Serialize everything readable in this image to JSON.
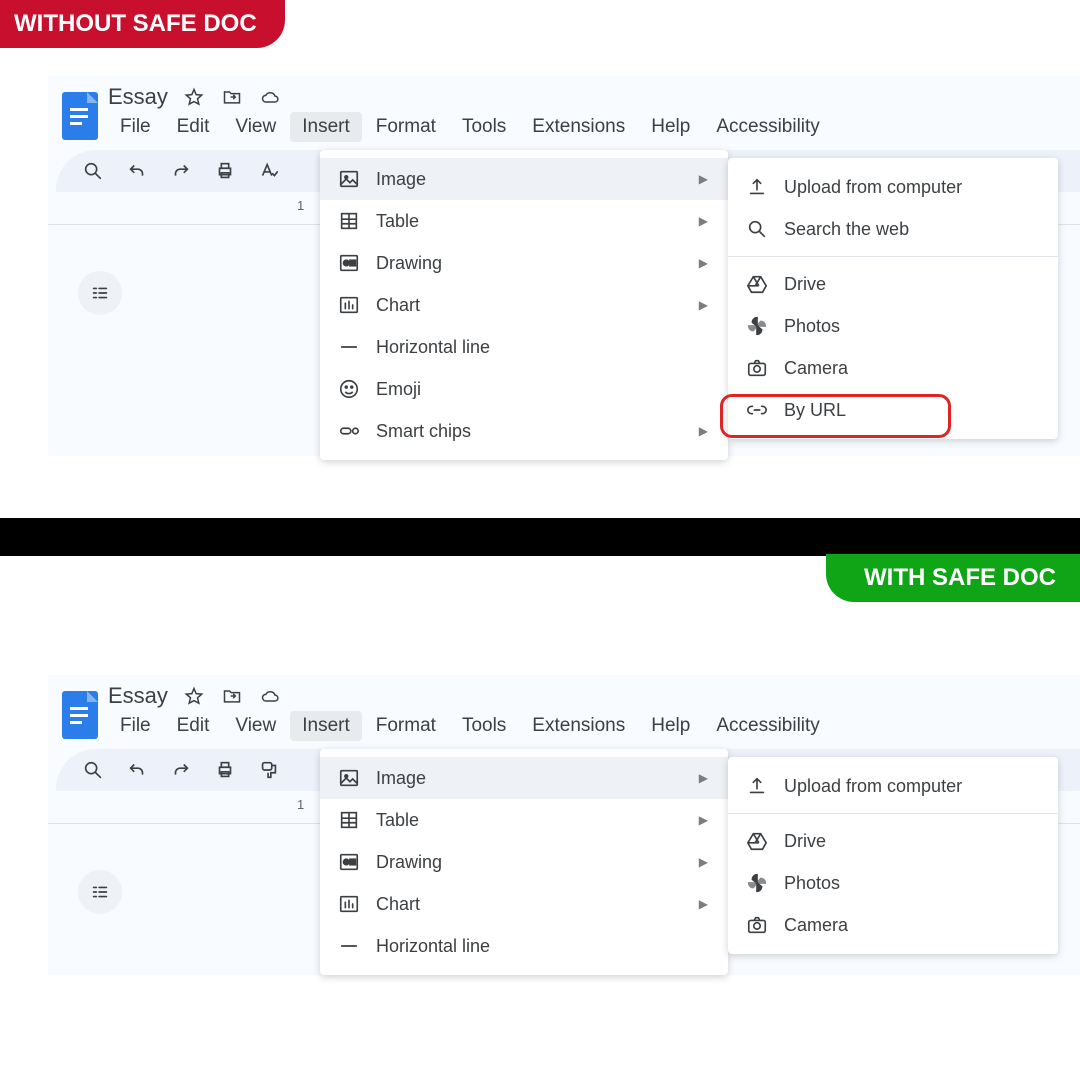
{
  "badges": {
    "without": "WITHOUT SAFE DOC",
    "with": "WITH SAFE DOC"
  },
  "doc": {
    "title": "Essay",
    "ruler": "1"
  },
  "menubar": [
    "File",
    "Edit",
    "View",
    "Insert",
    "Format",
    "Tools",
    "Extensions",
    "Help",
    "Accessibility"
  ],
  "insert_menu_top": [
    {
      "icon": "image",
      "label": "Image",
      "arrow": true,
      "hover": true
    },
    {
      "icon": "table",
      "label": "Table",
      "arrow": true
    },
    {
      "icon": "drawing",
      "label": "Drawing",
      "arrow": true
    },
    {
      "icon": "chart",
      "label": "Chart",
      "arrow": true
    },
    {
      "icon": "hline",
      "label": "Horizontal line"
    },
    {
      "icon": "emoji",
      "label": "Emoji"
    },
    {
      "icon": "chips",
      "label": "Smart chips",
      "arrow": true
    }
  ],
  "insert_menu_bottom": [
    {
      "icon": "image",
      "label": "Image",
      "arrow": true,
      "hover": true
    },
    {
      "icon": "table",
      "label": "Table",
      "arrow": true
    },
    {
      "icon": "drawing",
      "label": "Drawing",
      "arrow": true
    },
    {
      "icon": "chart",
      "label": "Chart",
      "arrow": true
    },
    {
      "icon": "hline",
      "label": "Horizontal line"
    }
  ],
  "image_menu_top": [
    {
      "icon": "upload",
      "label": "Upload from computer"
    },
    {
      "icon": "search",
      "label": "Search the web"
    },
    {
      "hr": true
    },
    {
      "icon": "drive",
      "label": "Drive"
    },
    {
      "icon": "photos",
      "label": "Photos"
    },
    {
      "icon": "camera",
      "label": "Camera"
    },
    {
      "icon": "link",
      "label": "By URL",
      "highlight": true
    }
  ],
  "image_menu_bottom": [
    {
      "icon": "upload",
      "label": "Upload from computer"
    },
    {
      "hr": true
    },
    {
      "icon": "drive",
      "label": "Drive"
    },
    {
      "icon": "photos",
      "label": "Photos"
    },
    {
      "icon": "camera",
      "label": "Camera"
    }
  ]
}
